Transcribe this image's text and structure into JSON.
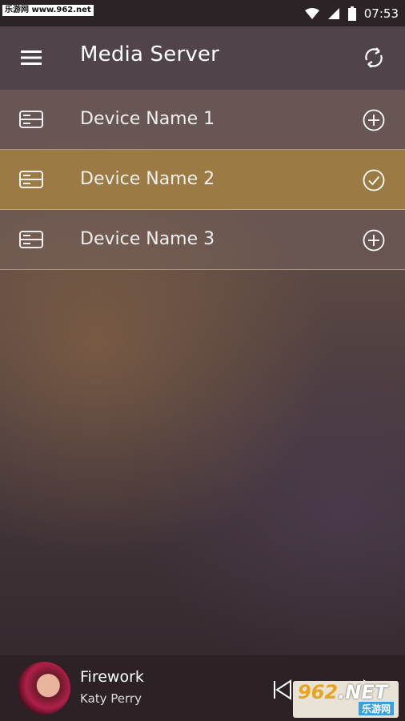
{
  "status_bar": {
    "watermark": "乐游网 www.962.net",
    "time": "07:53"
  },
  "app_bar": {
    "title": "Media Server"
  },
  "devices": [
    {
      "label": "Device Name 1",
      "state": "add"
    },
    {
      "label": "Device Name 2",
      "state": "selected"
    },
    {
      "label": "Device Name 3",
      "state": "add"
    }
  ],
  "player": {
    "title": "Firework",
    "artist": "Katy Perry"
  },
  "watermark_logo": {
    "big": "962",
    "net": ".NET",
    "small": "乐游网"
  },
  "colors": {
    "selected_row": "#9b7b43",
    "app_bar": "#51434a",
    "status_bar": "#2b2326"
  }
}
